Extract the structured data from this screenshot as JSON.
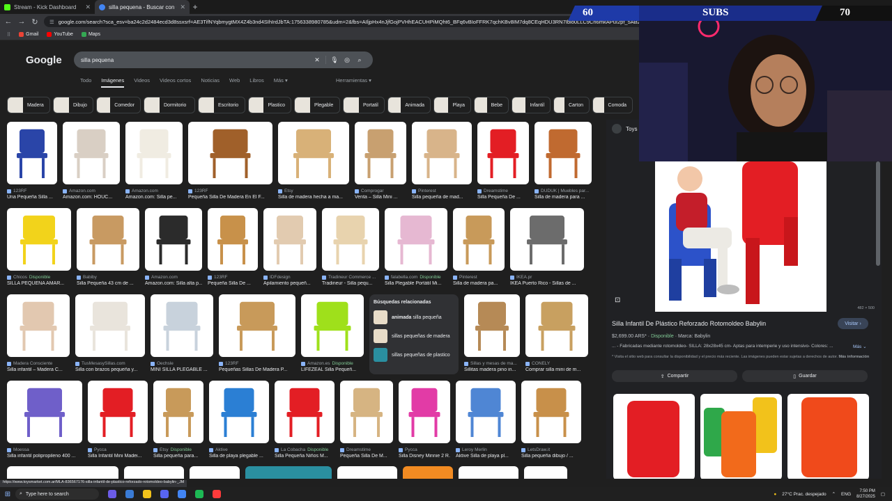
{
  "browser": {
    "tabs": [
      {
        "title": "Stream - Kick Dashboard",
        "color": "#53fc18"
      },
      {
        "title": "silla pequena - Buscar con Google",
        "color": "#4285f4"
      }
    ],
    "url": "google.com/search?sca_esv=ba24c2d2484ecd3d8ssxsrf=AE3TifNYqbmygtMX4Z4b3nd4SIhIrdJbTA:1756338980785&udm=2&fbs=AIljpHx4nJjfGojPVHhEACUHPiMQht6_BFq6vBIoFFRK7qchKBv8IM7dq8CEqHDU3RN7Ibio0LLC9Cn6mkAPuI2pf_5AB2jlEfeNRohFjG4KBYb9Qg7yH",
    "bookmarks": [
      "Gmail",
      "YouTube",
      "Maps"
    ]
  },
  "google": {
    "logo": "Google",
    "query": "silla pequena",
    "tabs": [
      "Todo",
      "Imágenes",
      "Videos",
      "Videos cortos",
      "Noticias",
      "Web",
      "Libros",
      "Más ▾"
    ],
    "tools": "Herramientas ▾",
    "chips": [
      "Madera",
      "Dibujo",
      "Comedor",
      "Dormitorio",
      "Escritorio",
      "Plastico",
      "Plegable",
      "Portatil",
      "Animada",
      "Playa",
      "Bebe",
      "Infantil",
      "Carton",
      "Comoda"
    ],
    "rows": [
      [
        {
          "src": "123RF",
          "cap": "Una Pequeña Silla ..."
        },
        {
          "src": "Amazon.com",
          "cap": "Amazon.com: HOUC..."
        },
        {
          "src": "Amazon.com",
          "cap": "Amazon.com: Silla pe..."
        },
        {
          "src": "123RF",
          "cap": "Pequeña Silla De Madera En El F..."
        },
        {
          "src": "Etsy",
          "cap": "Silla de madera hecha a ma..."
        },
        {
          "src": "Comprogar",
          "cap": "Venta – Silla Mini ..."
        },
        {
          "src": "Pinterest",
          "cap": "Silla pequeña de mad..."
        },
        {
          "src": "Dreamstime",
          "cap": "Silla Pequeña De ..."
        },
        {
          "src": "DUDUK | Muebles par...",
          "cap": "Silla de madera para ..."
        }
      ],
      [
        {
          "src": "Chicos",
          "avail": "Disponible",
          "cap": "SILLA PEQUEÑA AMAR..."
        },
        {
          "src": "Babiby",
          "cap": "Silla Pequeña 43 cm de ..."
        },
        {
          "src": "Amazon.com",
          "cap": "Amazon.com: Silla alta p..."
        },
        {
          "src": "123RF",
          "cap": "Pequeña Silla De ..."
        },
        {
          "src": "IDFdesign",
          "cap": "Apilamiento pequeñ..."
        },
        {
          "src": "Tradineur Commerce ...",
          "cap": "Tradineur - Silla pequ..."
        },
        {
          "src": "falabella.com",
          "avail": "Disponible",
          "cap": "Silla Plegable Portátil Mi..."
        },
        {
          "src": "Pinterest",
          "cap": "Silla de madera pa..."
        },
        {
          "src": "IKEA.pr",
          "cap": "IKEA Puerto Rico - Sillas de ..."
        }
      ],
      [
        {
          "src": "Madera Consciente",
          "cap": "Silla infantil – Madera C..."
        },
        {
          "src": "TusMesasySillas.com",
          "cap": "Silla con brazos pequeña y..."
        },
        {
          "src": "Oechsle",
          "cap": "MINI SILLA PLEGABLE ..."
        },
        {
          "src": "123RF",
          "cap": "Pequeñas Sillas De Madera P..."
        },
        {
          "src": "Amazon.es",
          "avail": "Disponible",
          "cap": "LIFEZEAL Silla Pequeñ..."
        },
        {
          "src": "Sillas y mesas de ma...",
          "cap": "Sillitas madera pino in..."
        },
        {
          "src": "CONELY",
          "cap": "Comprar silla mini de m..."
        }
      ],
      [
        {
          "src": "Moessa",
          "cap": "Silla infantil polipropileno 400 ..."
        },
        {
          "src": "Pycca",
          "cap": "Silla Infantil Mini Madei..."
        },
        {
          "src": "Etsy",
          "avail": "Disponible",
          "cap": "Silla pequeña para..."
        },
        {
          "src": "Aktive",
          "cap": "Silla de playa plegable ..."
        },
        {
          "src": "La Cobacha",
          "avail": "Disponible",
          "cap": "Silla Pequeña Niños M..."
        },
        {
          "src": "Dreamstime",
          "cap": "Pequeña Silla De M..."
        },
        {
          "src": "Pycca",
          "cap": "Silla Disney Minnie 2 R..."
        },
        {
          "src": "Leroy Merlin",
          "cap": "Aktive Silla de playa pl..."
        },
        {
          "src": "LetsDraw.it",
          "cap": "Silla pequeña dibujo / ..."
        }
      ]
    ],
    "related": {
      "title": "Búsquedas relacionadas",
      "items": [
        {
          "bold": "animada",
          "rest": " silla pequeña"
        },
        {
          "bold": "",
          "rest": "sillas pequeñas de madera"
        },
        {
          "bold": "",
          "rest": "sillas pequeñas de plastico"
        }
      ]
    }
  },
  "panel": {
    "site": "Toys",
    "dims": "482 × 500",
    "title": "Silla Infantil De Plástico Reforzado Rotomoldeo Babylin",
    "visit": "Visitar ›",
    "price": "$2,699.00 ARS*",
    "availability": "Disponible",
    "brand": "Marca: Babylin",
    "desc": "... - Fabricadas mediante rotomoldeo- SILLA: 28x28x45 cm- Aptas para intemperie y uso intensivo- Colores: ...",
    "more": "Más ⌄",
    "note": "* Visita el sitio web para consultar la disponibilidad y el precio más reciente. Las imágenes pueden estar sujetas a derechos de autor.",
    "note_link": "Más información",
    "share": "Compartir",
    "save": "Guardar"
  },
  "stream": {
    "left_count": "60",
    "label": "SUBS",
    "right_count": "70"
  },
  "statusbar": "https://www.toysmarket.com.ar/MLA-836567176-silla-infantil-de-plastico-reforzado-rotomoldeo-babylin-_JM",
  "taskbar": {
    "search": "Type here to search",
    "weather": "27°C  Prac. despejado",
    "lang": "ENG",
    "time": "7:50 PM",
    "date": "8/27/2025"
  }
}
